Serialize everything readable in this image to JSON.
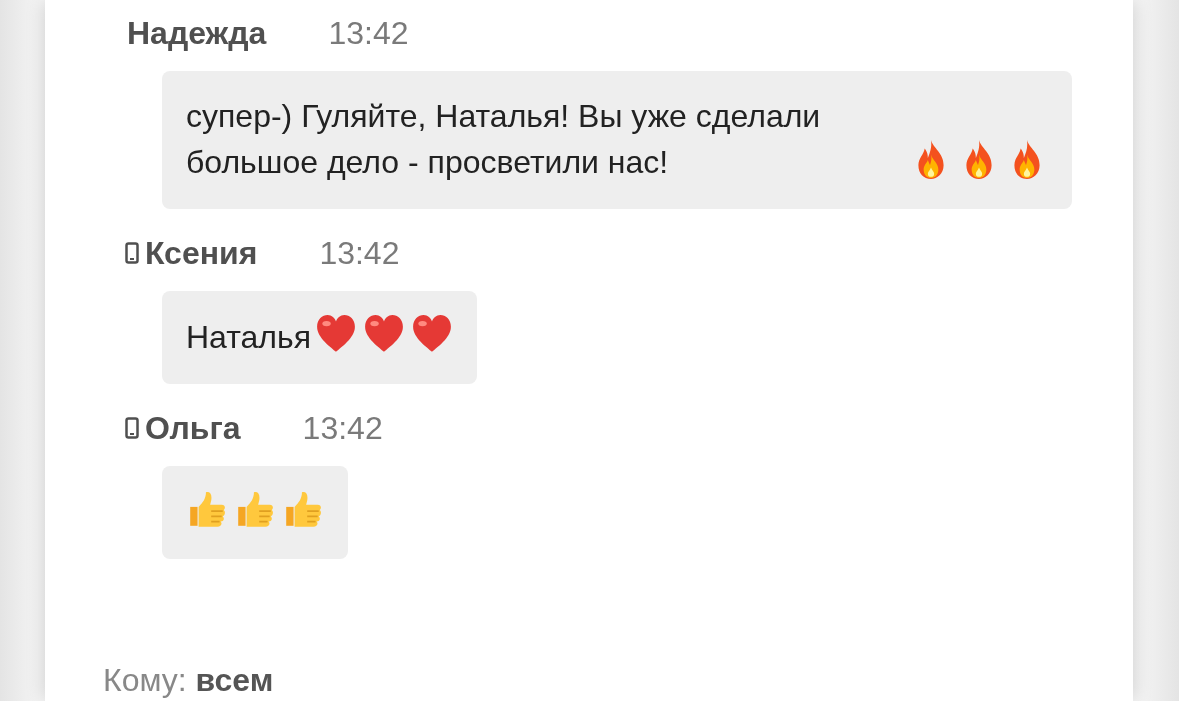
{
  "messages": [
    {
      "author": "Надежда",
      "from_phone": false,
      "time": "13:42",
      "text": "супер-) Гуляйте, Наталья! Вы уже сделали большое дело - просветили нас!",
      "emoji": [
        {
          "kind": "fire"
        },
        {
          "kind": "fire"
        },
        {
          "kind": "fire"
        }
      ]
    },
    {
      "author": "Ксения",
      "from_phone": true,
      "time": "13:42",
      "text": "Наталья",
      "emoji": [
        {
          "kind": "heart"
        },
        {
          "kind": "heart"
        },
        {
          "kind": "heart"
        }
      ]
    },
    {
      "author": "Ольга",
      "from_phone": true,
      "time": "13:42",
      "emoji": [
        {
          "kind": "thumbs-up"
        },
        {
          "kind": "thumbs-up"
        },
        {
          "kind": "thumbs-up"
        }
      ]
    }
  ],
  "recipient": "Кому: **всем**"
}
